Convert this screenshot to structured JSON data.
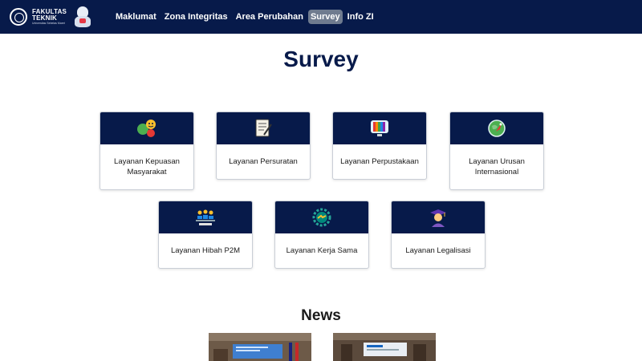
{
  "header": {
    "logo_line1": "FAKULTAS",
    "logo_line2": "TEKNIK",
    "logo_line3": "Universitas Sebelas Maret",
    "nav": [
      {
        "label": "Maklumat"
      },
      {
        "label": "Zona Integritas"
      },
      {
        "label": "Area Perubahan"
      },
      {
        "label": "Survey",
        "active": true
      },
      {
        "label": "Info ZI"
      }
    ]
  },
  "survey": {
    "title": "Survey",
    "cards": [
      {
        "label": "Layanan Kepuasan Masyarakat",
        "icon": "satisfaction-faces-icon"
      },
      {
        "label": "Layanan Persuratan",
        "icon": "document-pen-icon"
      },
      {
        "label": "Layanan Perpustakaan",
        "icon": "library-books-icon"
      },
      {
        "label": "Layanan Urusan Internasional",
        "icon": "globe-rocket-icon"
      },
      {
        "label": "Layanan Hibah P2M",
        "icon": "grant-people-icon"
      },
      {
        "label": "Layanan Kerja Sama",
        "icon": "handshake-gear-icon"
      },
      {
        "label": "Layanan Legalisasi",
        "icon": "graduate-icon"
      }
    ]
  },
  "news": {
    "title": "News",
    "items": [
      {
        "image": "news-photo-1"
      },
      {
        "image": "news-photo-2"
      }
    ]
  }
}
